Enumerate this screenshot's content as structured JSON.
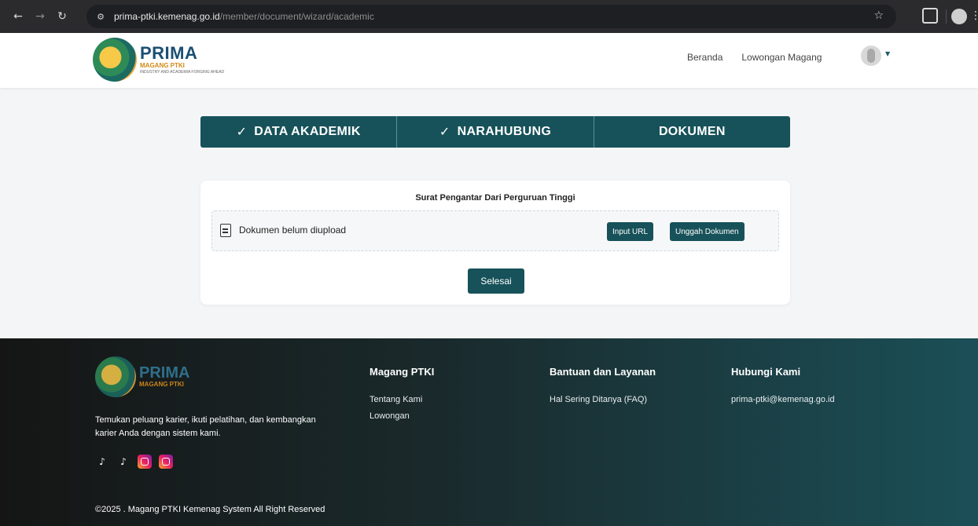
{
  "browser": {
    "url_host": "prima-ptki.kemenag.go.id",
    "url_path": "/member/document/wizard/academic"
  },
  "header": {
    "logo_title": "PRIMA",
    "logo_sub": "MAGANG PTKI",
    "logo_tag": "INDUSTRY AND ACADEMIA FORGING AHEAD",
    "nav": {
      "beranda": "Beranda",
      "lowongan": "Lowongan Magang"
    }
  },
  "steps": [
    {
      "label": "DATA AKADEMIK",
      "check": "✓"
    },
    {
      "label": "NARAHUBUNG",
      "check": "✓"
    },
    {
      "label": "DOKUMEN"
    }
  ],
  "card": {
    "title": "Surat Pengantar Dari Perguruan Tinggi",
    "doc_status": "Dokumen belum diupload",
    "input_url_label": "Input URL",
    "upload_label": "Unggah Dokumen",
    "finish_label": "Selesai"
  },
  "footer": {
    "logo_title": "PRIMA",
    "logo_sub": "MAGANG PTKI",
    "description": "Temukan peluang karier, ikuti pelatihan, dan kembangkan karier Anda dengan sistem kami.",
    "socials": [
      "tiktok-icon",
      "tiktok-icon",
      "instagram-icon",
      "instagram-icon"
    ],
    "col1": {
      "title": "Magang PTKI",
      "links": [
        "Tentang Kami",
        "Lowongan"
      ]
    },
    "col2": {
      "title": "Bantuan dan Layanan",
      "links": [
        "Hal Sering Ditanya (FAQ)"
      ]
    },
    "col3": {
      "title": "Hubungi Kami",
      "links": [
        "prima-ptki@kemenag.go.id"
      ]
    },
    "copyright": "©2025 . Magang PTKI Kemenag System All Right Reserved"
  },
  "colors": {
    "primary": "#17525a",
    "footer_start": "#151515",
    "footer_end": "#1b4f57"
  }
}
